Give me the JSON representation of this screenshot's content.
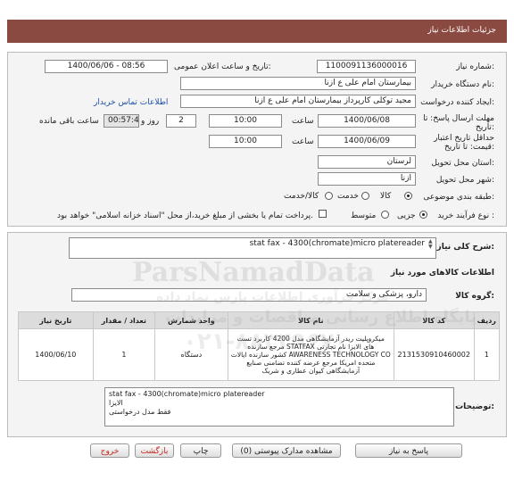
{
  "header": {
    "title": "جزئیات اطلاعات نیاز"
  },
  "form": {
    "need_number_label": "شماره نیاز:",
    "need_number": "1100091136000016",
    "announce_datetime_label": "تاریخ و ساعت اعلان عمومی:",
    "announce_datetime": "1400/06/06 - 08:56",
    "buyer_org_label": "نام دستگاه خریدار:",
    "buyer_org": "بیمارستان امام علی ع ازنا",
    "creator_label": "ایجاد کننده درخواست:",
    "creator": "مجید توکلی کارپرداز بیمارستان امام علی ع ازنا",
    "buyer_contact_link": "اطلاعات تماس خریدار",
    "deadline_label": "مهلت ارسال پاسخ: تا تاریخ:",
    "deadline_date": "1400/06/08",
    "time_label": "ساعت",
    "deadline_time": "10:00",
    "days_value": "2",
    "days_label": "روز و",
    "remaining_time": "00:57:44",
    "remaining_label": "ساعت باقی مانده",
    "validity_label": "حداقل تاریخ اعتبار قیمت: تا تاریخ:",
    "validity_date": "1400/06/09",
    "validity_time": "10:00",
    "province_label": "استان محل تحویل:",
    "province": "لرستان",
    "city_label": "شهر محل تحویل:",
    "city": "ازنا",
    "category_label": "طبقه بندی موضوعی:",
    "category_options": [
      "کالا",
      "خدمت",
      "کالا/خدمت"
    ],
    "process_label": "نوع فرآیند خرید :",
    "process_options": [
      "جزیی",
      "متوسط"
    ],
    "payment_note": "پرداخت تمام یا بخشی از مبلغ خرید،از محل \"اسناد خزانه اسلامی\" خواهد بود."
  },
  "need_summary": {
    "label": "شرح کلی نیاز:",
    "value": "stat fax - 4300(chromate)micro platereader"
  },
  "goods": {
    "section_title": "اطلاعات کالاهای مورد نیاز",
    "group_label": "گروه کالا:",
    "group_value": "دارو، پزشکی و سلامت",
    "columns": [
      "ردیف",
      "کد کالا",
      "نام کالا",
      "واحد شمارش",
      "تعداد / مقدار",
      "تاریخ نیاز"
    ],
    "rows": [
      {
        "index": "1",
        "code": "2131530910460002",
        "name": "میکروپلیت ریدر آزمایشگاهی مدل 4200 کاربرد تست های الایزا نام تجارتی STATFAX مرجع سازنده AWARENESS TECHNOLOGY CO کشور سازنده ایالات متحده امریکا مرجع عرضه کننده تضامنی صنایع آزمایشگاهی کیوان عطاری و شریک",
        "unit": "دستگاه",
        "qty": "1",
        "date": "1400/06/10"
      }
    ]
  },
  "buyer_notes": {
    "label": "توضیحات خریدار:",
    "lines": [
      "stat fax - 4300(chromate)micro platereader",
      "الایزا",
      "فقط مدل درخواستی"
    ]
  },
  "buttons": {
    "reply": "پاسخ به نیاز",
    "attachments": "مشاهده مدارک پیوستی (0)",
    "print": "چاپ",
    "back": "بازگشت",
    "exit": "خروج"
  },
  "watermark": {
    "line1": "ParsNamadData",
    "line2": "مرکز فرآوری اطلاعات پارس نماد داده",
    "line3": "پایگاه اطلاع رسانی مناقصات و مزایدات",
    "line4": "۰۲۱-۸۸۳۴۹۶۷۰"
  }
}
